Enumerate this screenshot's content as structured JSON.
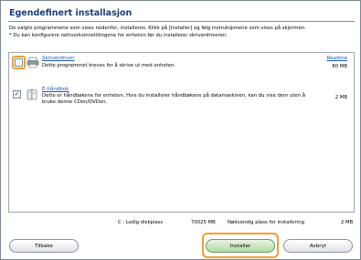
{
  "dialog": {
    "title": "Egendefinert installasjon",
    "intro_line1": "De valgte programmene som vises nedenfor, installeres. Klikk på [Installer] og følg instruksjonene som vises på skjermen.",
    "intro_line2": "* Du kan konfigurere nettverksinnstillingene for enheten før du installerer skriverdriveren."
  },
  "items": [
    {
      "name": "Skriverdriver",
      "description": "Dette programmet kreves for å skrive ut med enheten.",
      "size": "80 MB",
      "link": "Readme",
      "checked": false,
      "icon": "printer-icon"
    },
    {
      "name": "E-håndbok",
      "description_line1": "Dette er håndbøkene for enheten. Hvis du installerer håndbøkene på datamaskinen, kan du vise dem uten å",
      "description_line2": "bruke denne CDen/DVDen.",
      "size": "2 MB",
      "checked": true,
      "check_glyph": "✓",
      "icon": "manual-icon"
    }
  ],
  "disk": {
    "free_label": "C : Ledig diskplass",
    "free_value": "70025 MB",
    "required_label": "Nødvendig plass for installering",
    "required_value": "2 MB"
  },
  "buttons": {
    "back": "Tilbake",
    "install": "Installer",
    "cancel": "Avbryt"
  },
  "colors": {
    "title": "#1a3d7a",
    "link": "#1d57b7",
    "focus": "#f0a030"
  }
}
